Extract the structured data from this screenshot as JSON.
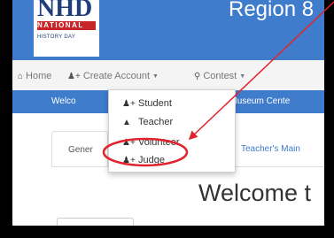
{
  "header": {
    "logo": {
      "nhd": "NHD",
      "national": "NATIONAL",
      "history_day": "HISTORY DAY"
    },
    "region_title": "Region 8"
  },
  "navbar": {
    "home_label": "Home",
    "create_account_label": "Create Account",
    "contest_label": "Contest"
  },
  "dropdown": {
    "items": [
      {
        "label": "Student",
        "icon": "add-user-icon"
      },
      {
        "label": "Teacher",
        "icon": "graduation-cap-icon"
      },
      {
        "label": "Volunteer",
        "icon": "add-user-icon"
      },
      {
        "label": "Judge",
        "icon": "add-user-icon"
      }
    ]
  },
  "welcome_bar": {
    "left_text": "Welco",
    "right_text": "nnati Museum Cente"
  },
  "tabs": {
    "general": "Gener",
    "teachers_main": "Teacher's Main"
  },
  "main": {
    "heading": "Welcome t"
  },
  "annotation": {
    "color": "#e0242d"
  },
  "colors": {
    "brand_blue": "#3f7ccb",
    "logo_red": "#c8252b",
    "logo_navy": "#1f3f7a"
  }
}
